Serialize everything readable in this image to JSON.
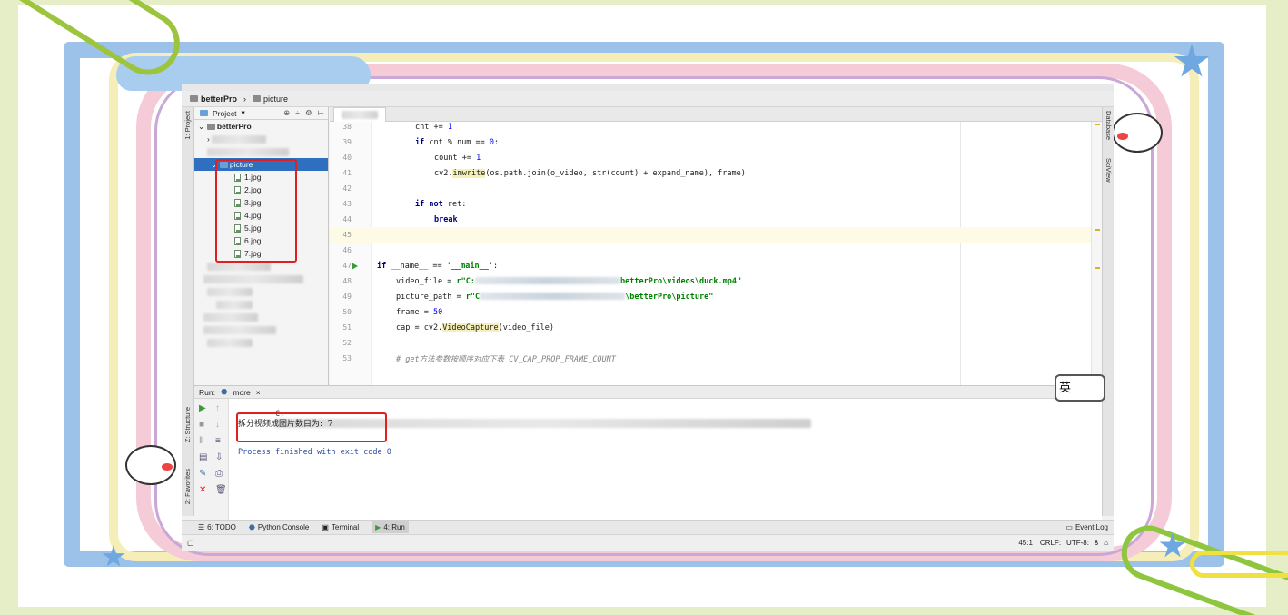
{
  "breadcrumb": {
    "project": "betterPro",
    "folder": "picture"
  },
  "project_panel": {
    "header_label": "Project",
    "root": "betterPro",
    "selected_folder": "picture",
    "files": [
      "1.jpg",
      "2.jpg",
      "3.jpg",
      "4.jpg",
      "5.jpg",
      "6.jpg",
      "7.jpg"
    ]
  },
  "left_tabs": {
    "project": "1: Project",
    "structure": "Z: Structure",
    "favorites": "2: Favorites"
  },
  "right_tabs": {
    "database": "Database",
    "sciview": "SciView"
  },
  "editor": {
    "lines": [
      {
        "n": "38",
        "code": "cnt += 1"
      },
      {
        "n": "39",
        "code": "if cnt % num == 0:"
      },
      {
        "n": "40",
        "code": "count += 1"
      },
      {
        "n": "41",
        "code": "cv2.imwrite(os.path.join(o_video, str(count) + expand_name), frame)"
      },
      {
        "n": "42",
        "code": ""
      },
      {
        "n": "43",
        "code": "if not ret:"
      },
      {
        "n": "44",
        "code": "break"
      },
      {
        "n": "45",
        "code": ""
      },
      {
        "n": "46",
        "code": ""
      },
      {
        "n": "47",
        "code": "if __name__ == '__main__':"
      },
      {
        "n": "48",
        "code": "video_file = r\"C:",
        "tail": "betterPro\\videos\\duck.mp4\""
      },
      {
        "n": "49",
        "code": "picture_path = r\"C",
        "tail": "\\betterPro\\picture\""
      },
      {
        "n": "50",
        "code": "frame = 50"
      },
      {
        "n": "51",
        "code": "cap = cv2.VideoCapture(video_file)"
      },
      {
        "n": "52",
        "code": ""
      },
      {
        "n": "53",
        "code": "# get方法参数按顺序对应下表 CV_CAP_PROP_FRAME_COUNT"
      }
    ]
  },
  "run": {
    "label": "Run:",
    "config": "more",
    "path_prefix": "C:",
    "result": "拆分视频成图片数目为:  7",
    "finished": "Process finished with exit code 0"
  },
  "tooltabs": [
    {
      "label": "6: TODO",
      "icon": "todo-icon"
    },
    {
      "label": "Python Console",
      "icon": "python-icon"
    },
    {
      "label": "Terminal",
      "icon": "terminal-icon"
    },
    {
      "label": "4: Run",
      "icon": "run-icon"
    }
  ],
  "status": {
    "event_log": "Event Log",
    "position": "45:1",
    "line_sep": "CRLF:",
    "encoding": "UTF-8:"
  },
  "ime": {
    "label": "英"
  },
  "colors": {
    "selection": "#2f6fc0",
    "red_box": "#e02020",
    "run_green": "#3a9a3a",
    "current_line": "#fdfbe6"
  }
}
